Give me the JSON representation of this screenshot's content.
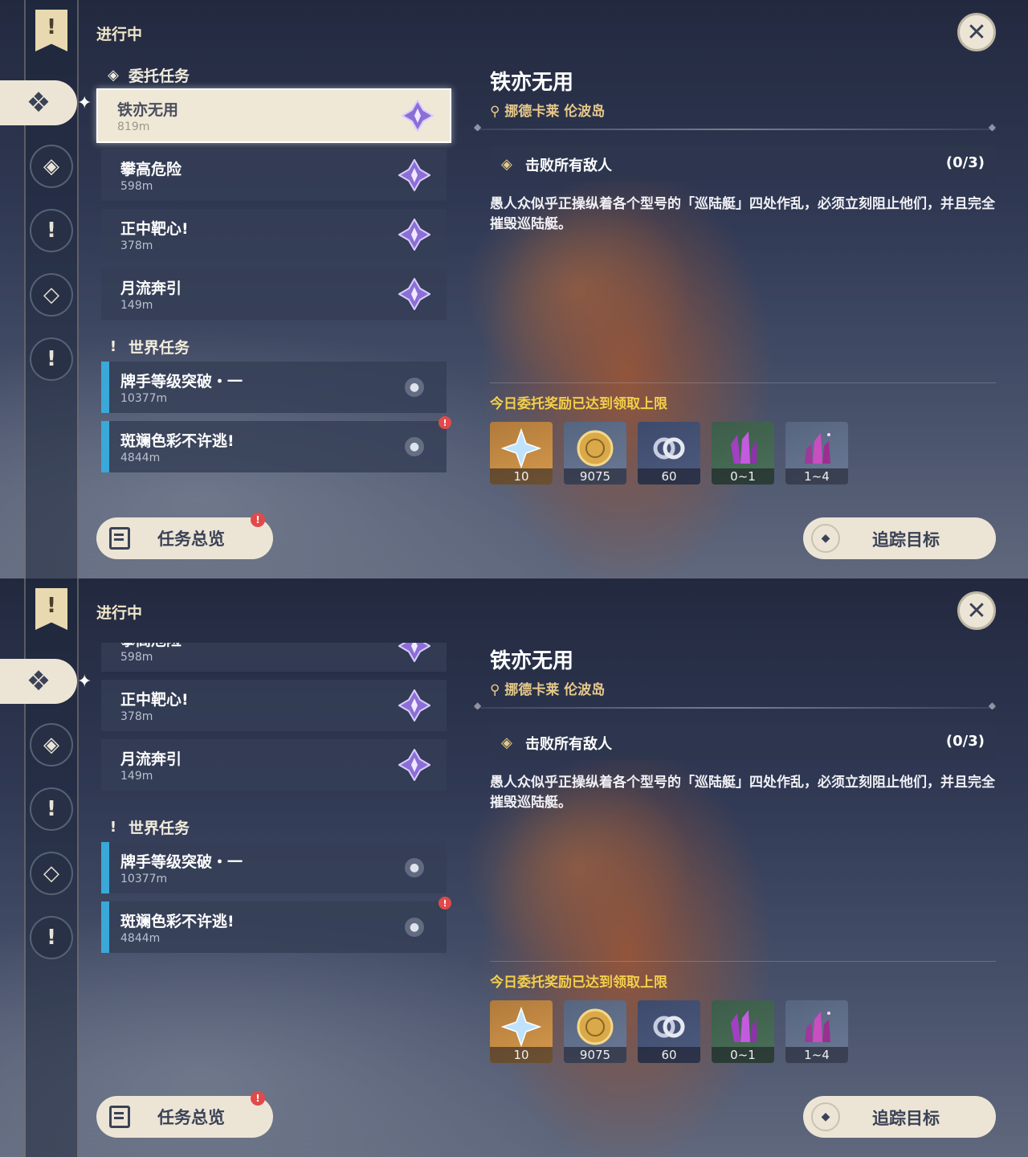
{
  "header": {
    "status": "进行中"
  },
  "sections": {
    "commission": {
      "title": "委托任务"
    },
    "world": {
      "title": "世界任务"
    }
  },
  "commission_quests": [
    {
      "name": "铁亦无用",
      "distance": "819m"
    },
    {
      "name": "攀高危险",
      "distance": "598m"
    },
    {
      "name": "正中靶心!",
      "distance": "378m"
    },
    {
      "name": "月流奔引",
      "distance": "149m"
    }
  ],
  "world_quests": [
    {
      "name": "牌手等级突破・一",
      "distance": "10377m"
    },
    {
      "name": "斑斓色彩不许逃!",
      "distance": "4844m"
    }
  ],
  "detail": {
    "title": "铁亦无用",
    "location": "挪德卡莱 伦波岛",
    "objective": "击败所有敌人",
    "progress": "(0/3)",
    "description": "愚人众似乎正操纵着各个型号的「巡陆艇」四处作乱，必须立刻阻止他们，并且完全摧毁巡陆艇。",
    "reward_note": "今日委托奖励已达到领取上限",
    "rewards": [
      {
        "icon": "primogem-icon",
        "count": "10"
      },
      {
        "icon": "mora-coin-icon",
        "count": "9075"
      },
      {
        "icon": "companionship-exp-icon",
        "count": "60"
      },
      {
        "icon": "green-crystal-icon",
        "count": "0~1"
      },
      {
        "icon": "purple-crystal-icon",
        "count": "1~4"
      }
    ]
  },
  "buttons": {
    "overview": "任务总览",
    "track": "追踪目标",
    "close": "✕"
  },
  "icons": {
    "banner": "!",
    "notice": "!"
  },
  "colors": {
    "accent_cream": "#ece5d6",
    "reward_note": "#f3cf4b",
    "location": "#e6c98a",
    "world_bar": "#3aa8d8",
    "notice": "#e14a4a"
  }
}
